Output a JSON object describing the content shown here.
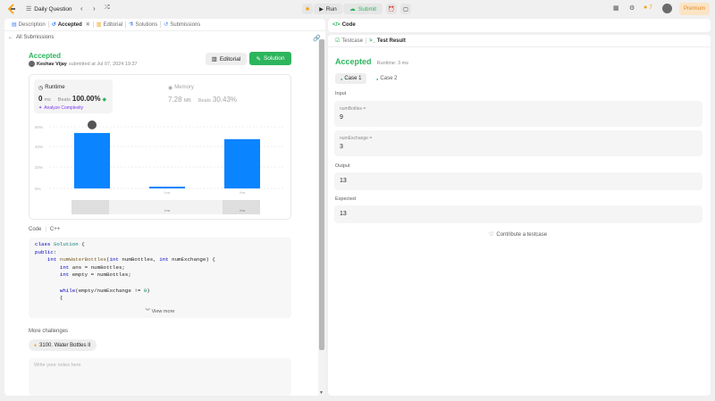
{
  "topbar": {
    "title": "Daily Question",
    "run": "Run",
    "submit": "Submit",
    "streak": "7",
    "premium": "Premium"
  },
  "left_tabs": [
    "Description",
    "Accepted",
    "Editorial",
    "Solutions",
    "Submissions"
  ],
  "back_link": "All Submissions",
  "submission": {
    "status": "Accepted",
    "user": "Keshav Vijay",
    "submitted": "submitted at Jul 07, 2024 19:37",
    "editorial_btn": "Editorial",
    "solution_btn": "Solution"
  },
  "runtime": {
    "label": "Runtime",
    "value": "0",
    "unit": "ms",
    "beats_label": "Beats",
    "beats": "100.00%",
    "analyze": "Analyze Complexity"
  },
  "memory": {
    "label": "Memory",
    "value": "7.28",
    "unit": "MB",
    "beats_label": "Beats",
    "beats": "30.43%"
  },
  "chart_data": {
    "type": "bar",
    "yticks": [
      "80%",
      "40%",
      "20%",
      "0%"
    ],
    "categories": [
      "",
      "1ms",
      "2ms"
    ],
    "values": [
      45,
      1,
      40
    ],
    "ylim": [
      0,
      80
    ],
    "highlight": "#0a84ff",
    "bottom_labels": [
      "",
      "1ms",
      "2ms"
    ]
  },
  "code": {
    "header": "Code",
    "lang": "C++",
    "view_more": "View more",
    "lines": [
      "class Solution {",
      "public:",
      "    int numWaterBottles(int numBottles, int numExchange) {",
      "        int ans = numBottles;",
      "        int empty = numBottles;",
      "",
      "        while(empty/numExchange != 0)",
      "        {"
    ]
  },
  "more": {
    "title": "More challenges",
    "item": "3100. Water Bottles II",
    "notes_placeholder": "Write your notes here"
  },
  "right": {
    "code_tab": "Code",
    "testcase_tab": "Testcase",
    "result_tab": "Test Result",
    "status": "Accepted",
    "runtime": "Runtime: 3 ms",
    "case1": "Case 1",
    "case2": "Case 2",
    "input_label": "Input",
    "p1_name": "numBottles =",
    "p1_val": "9",
    "p2_name": "numExchange =",
    "p2_val": "3",
    "output_label": "Output",
    "output_val": "13",
    "expected_label": "Expected",
    "expected_val": "13",
    "contribute": "Contribute a testcase"
  }
}
